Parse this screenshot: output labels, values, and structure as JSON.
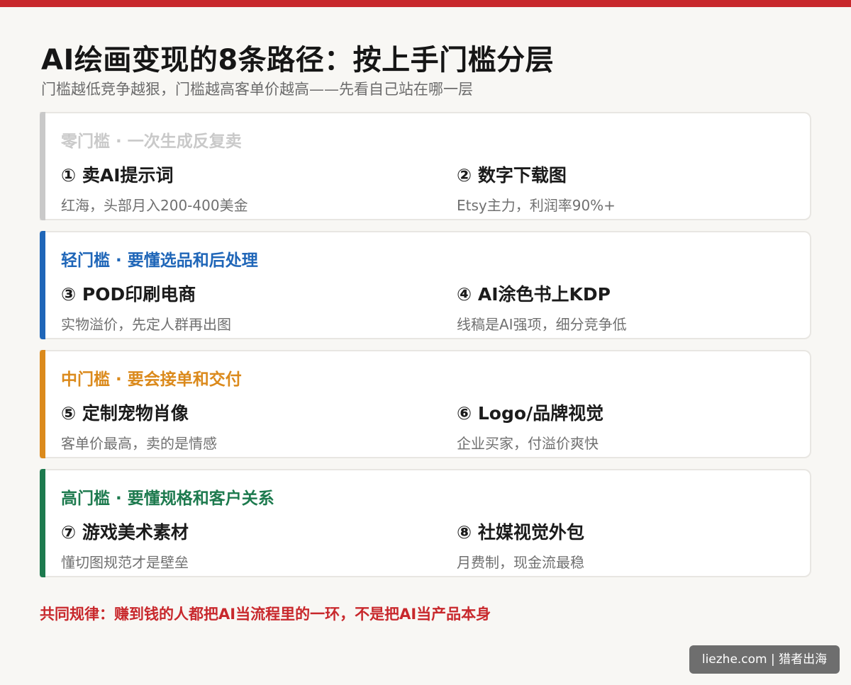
{
  "header": {
    "title": "AI绘画变现的8条路径：按上手门槛分层",
    "subtitle": "门槛越低竞争越狠，门槛越高客单价越高——先看自己站在哪一层"
  },
  "tiers": [
    {
      "label": "零门槛 · 一次生成反复卖",
      "color": "#c9c9c9",
      "items": [
        {
          "name": "① 卖AI提示词",
          "desc": "红海，头部月入200-400美金"
        },
        {
          "name": "② 数字下载图",
          "desc": "Etsy主力，利润率90%+"
        }
      ]
    },
    {
      "label": "轻门槛 · 要懂选品和后处理",
      "color": "#1f66b8",
      "items": [
        {
          "name": "③ POD印刷电商",
          "desc": "实物溢价，先定人群再出图"
        },
        {
          "name": "④ AI涂色书上KDP",
          "desc": "线稿是AI强项，细分竞争低"
        }
      ]
    },
    {
      "label": "中门槛 · 要会接单和交付",
      "color": "#db8a1c",
      "items": [
        {
          "name": "⑤ 定制宠物肖像",
          "desc": "客单价最高，卖的是情感"
        },
        {
          "name": "⑥ Logo/品牌视觉",
          "desc": "企业买家，付溢价爽快"
        }
      ]
    },
    {
      "label": "高门槛 · 要懂规格和客户关系",
      "color": "#1d7a4e",
      "items": [
        {
          "name": "⑦ 游戏美术素材",
          "desc": "懂切图规范才是壁垒"
        },
        {
          "name": "⑧ 社媒视觉外包",
          "desc": "月费制，现金流最稳"
        }
      ]
    }
  ],
  "footer": {
    "note": "共同规律：赚到钱的人都把AI当流程里的一环，不是把AI当产品本身"
  },
  "watermark": {
    "text": "liezhe.com | 猎者出海"
  },
  "colors": {
    "brand_red": "#c8282c",
    "background": "#f8f7f4"
  }
}
